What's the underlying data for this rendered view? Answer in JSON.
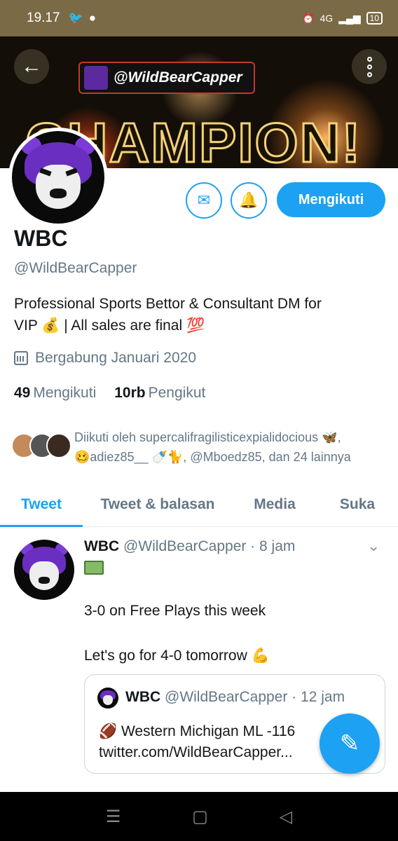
{
  "status_bar": {
    "time": "19.17",
    "network": "4G",
    "battery": "10"
  },
  "banner": {
    "badge_text": "@WildBearCapper",
    "headline": "CHAMPION!"
  },
  "profile": {
    "name": "WBC",
    "handle": "@WildBearCapper",
    "bio_line1": "Professional Sports Bettor & Consultant   DM for",
    "bio_line2": "VIP 💰 |  All sales are final 💯",
    "joined": "Bergabung Januari 2020",
    "following_count": "49",
    "following_label": "Mengikuti",
    "followers_count": "10rb",
    "followers_label": "Pengikut",
    "follow_button": "Mengikuti",
    "followed_by_line1": "Diikuti oleh supercalifragilisticexpialidocious 🦋,",
    "followed_by_line2": "🥴adiez85__ 🍼🐈, @Mboedz85, dan 24 lainnya"
  },
  "tabs": [
    "Tweet",
    "Tweet & balasan",
    "Media",
    "Suka"
  ],
  "tweet": {
    "name": "WBC",
    "handle_time": "@WildBearCapper · 8 jam",
    "line1": "3-0 on Free Plays this week",
    "line2": "Let's go for 4-0 tomorrow 💪",
    "quote": {
      "name": "WBC",
      "handle_time": "@WildBearCapper · 12 jam",
      "line1": "🏈 Western Michigan ML -116",
      "line2": "twitter.com/WildBearCapper..."
    }
  },
  "colors": {
    "accent": "#1da1f2",
    "status_bar": "#7a6a45"
  },
  "icons": [
    "back-arrow-icon",
    "more-vertical-icon",
    "mail-icon",
    "bell-plus-icon",
    "calendar-icon",
    "chevron-down-icon",
    "compose-icon"
  ]
}
